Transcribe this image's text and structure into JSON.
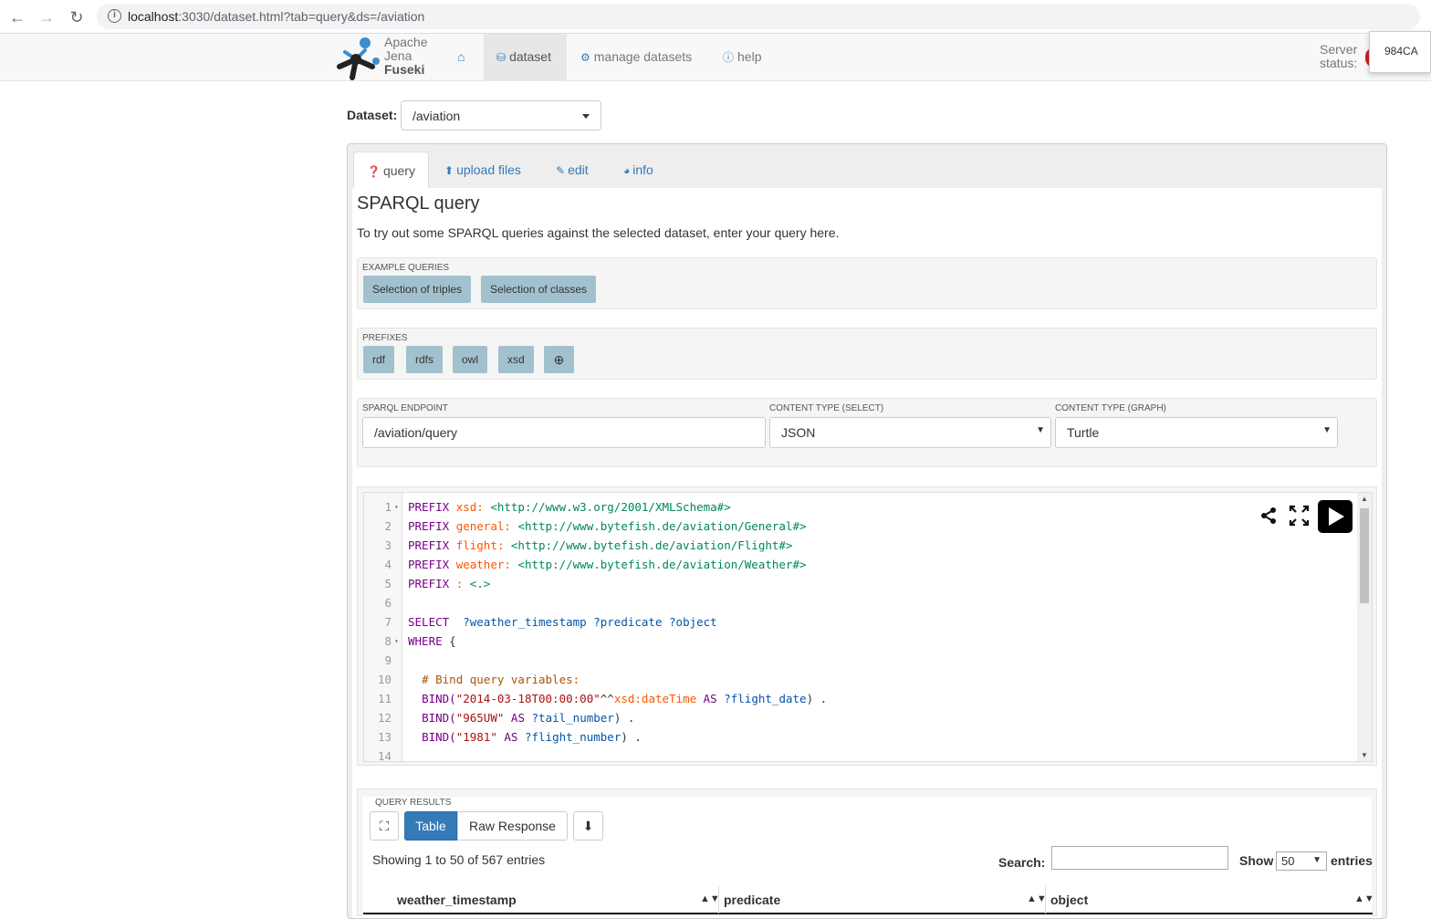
{
  "browser": {
    "nav_back_icon": "back-arrow-icon",
    "url_host": "localhost",
    "url_rest": ":3030/dataset.html?tab=query&ds=/aviation"
  },
  "navbar": {
    "logo": {
      "line1": "Apache",
      "line2": "Jena",
      "line3": "Fuseki"
    },
    "links": {
      "dataset": "dataset",
      "manage": "manage datasets",
      "help": "help"
    },
    "server_status": {
      "line1": "Server",
      "line2": "status:"
    },
    "tooltip": "984CA"
  },
  "dataset": {
    "label": "Dataset:",
    "selected": "/aviation"
  },
  "tabs": {
    "query": "query",
    "upload": "upload files",
    "edit": "edit",
    "info": "info"
  },
  "query": {
    "title": "SPARQL query",
    "intro": "To try out some SPARQL queries against the selected dataset, enter your query here.",
    "examples_label": "EXAMPLE QUERIES",
    "examples": [
      "Selection of triples",
      "Selection of classes"
    ],
    "prefixes_label": "PREFIXES",
    "prefixes": [
      "rdf",
      "rdfs",
      "owl",
      "xsd"
    ],
    "endpoint_label": "SPARQL ENDPOINT",
    "endpoint": "/aviation/query",
    "ct_select_label": "CONTENT TYPE (SELECT)",
    "ct_select": "JSON",
    "ct_graph_label": "CONTENT TYPE (GRAPH)",
    "ct_graph": "Turtle"
  },
  "editor": {
    "lines": [
      {
        "n": "1",
        "fold": true
      },
      {
        "n": "2"
      },
      {
        "n": "3"
      },
      {
        "n": "4"
      },
      {
        "n": "5"
      },
      {
        "n": "6"
      },
      {
        "n": "7"
      },
      {
        "n": "8",
        "fold": true
      },
      {
        "n": "9"
      },
      {
        "n": "10"
      },
      {
        "n": "11"
      },
      {
        "n": "12"
      },
      {
        "n": "13"
      },
      {
        "n": "14"
      }
    ],
    "code": {
      "l1": [
        "PREFIX",
        "xsd:",
        "<http://www.w3.org/2001/XMLSchema#>"
      ],
      "l2": [
        "PREFIX",
        "general:",
        "<http://www.bytefish.de/aviation/General#>"
      ],
      "l3": [
        "PREFIX",
        "flight:",
        "<http://www.bytefish.de/aviation/Flight#>"
      ],
      "l4": [
        "PREFIX",
        "weather:",
        "<http://www.bytefish.de/aviation/Weather#>"
      ],
      "l5": [
        "PREFIX",
        ":",
        "<.>"
      ],
      "l7": [
        "SELECT",
        "?weather_timestamp",
        "?predicate",
        "?object"
      ],
      "l8": [
        "WHERE",
        "{"
      ],
      "l10": "# Bind query variables:",
      "l11": [
        "BIND(",
        "\"2014-03-18T00:00:00\"",
        "^^",
        "xsd:dateTime",
        "AS",
        "?flight_date",
        ") ."
      ],
      "l12": [
        "BIND(",
        "\"965UW\"",
        "AS",
        "?tail_number",
        ") ."
      ],
      "l13": [
        "BIND(",
        "\"1981\"",
        "AS",
        "?flight_number",
        ") ."
      ]
    }
  },
  "results": {
    "label": "QUERY RESULTS",
    "view_table": "Table",
    "view_raw": "Raw Response",
    "showing": "Showing 1 to 50 of 567 entries",
    "search_label": "Search:",
    "show_label": "Show",
    "show_value": "50",
    "entries_label": "entries",
    "columns": [
      "weather_timestamp",
      "predicate",
      "object"
    ]
  },
  "colors": {
    "accent": "#337ab7",
    "pill": "#a2c1cf",
    "status_red": "#cc1f1f"
  }
}
